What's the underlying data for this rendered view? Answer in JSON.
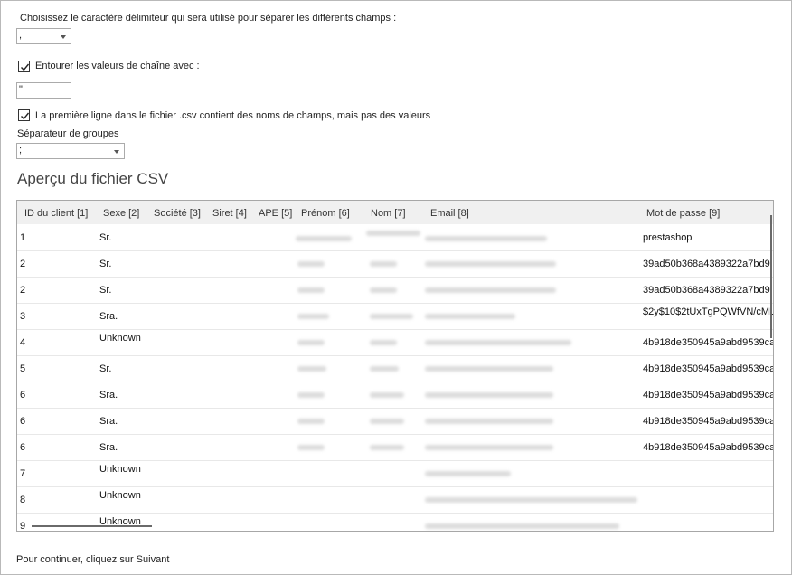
{
  "delimiter": {
    "label": "Choisissez le caractère délimiteur qui sera utilisé pour séparer les différents champs :",
    "value": ","
  },
  "quote_option": {
    "label": "Entourer les valeurs de chaîne avec :",
    "checked": true,
    "value": "\""
  },
  "header_option": {
    "label": "La première ligne dans le fichier .csv contient des noms de champs, mais pas des valeurs",
    "checked": true
  },
  "group_separator": {
    "label": "Séparateur de groupes",
    "value": ";"
  },
  "preview": {
    "title": "Aperçu du fichier CSV",
    "columns": [
      "ID du client [1]",
      "Sexe [2]",
      "Société [3]",
      "Siret [4]",
      "APE [5]",
      "Prénom [6]",
      "Nom [7]",
      "Email [8]",
      "Mot de passe [9]"
    ],
    "rows": [
      {
        "id": "1",
        "sexe": "Sr.",
        "password": "prestashop"
      },
      {
        "id": "2",
        "sexe": "Sr.",
        "password": "39ad50b368a4389322a7bd9"
      },
      {
        "id": "2",
        "sexe": "Sr.",
        "password": "39ad50b368a4389322a7bd9"
      },
      {
        "id": "3",
        "sexe": "Sra.",
        "password": "$2y$10$2tUxTgPQWfVN/cML"
      },
      {
        "id": "4",
        "sexe": "Unknown",
        "password": "4b918de350945a9abd9539ca"
      },
      {
        "id": "5",
        "sexe": "Sr.",
        "password": "4b918de350945a9abd9539ca"
      },
      {
        "id": "6",
        "sexe": "Sra.",
        "password": "4b918de350945a9abd9539ca"
      },
      {
        "id": "6",
        "sexe": "Sra.",
        "password": "4b918de350945a9abd9539ca"
      },
      {
        "id": "6",
        "sexe": "Sra.",
        "password": "4b918de350945a9abd9539ca"
      },
      {
        "id": "7",
        "sexe": "Unknown",
        "password": ""
      },
      {
        "id": "8",
        "sexe": "Unknown",
        "password": ""
      },
      {
        "id": "9",
        "sexe": "Unknown",
        "password": ""
      }
    ]
  },
  "footer": {
    "text": "Pour continuer, cliquez sur Suivant"
  }
}
